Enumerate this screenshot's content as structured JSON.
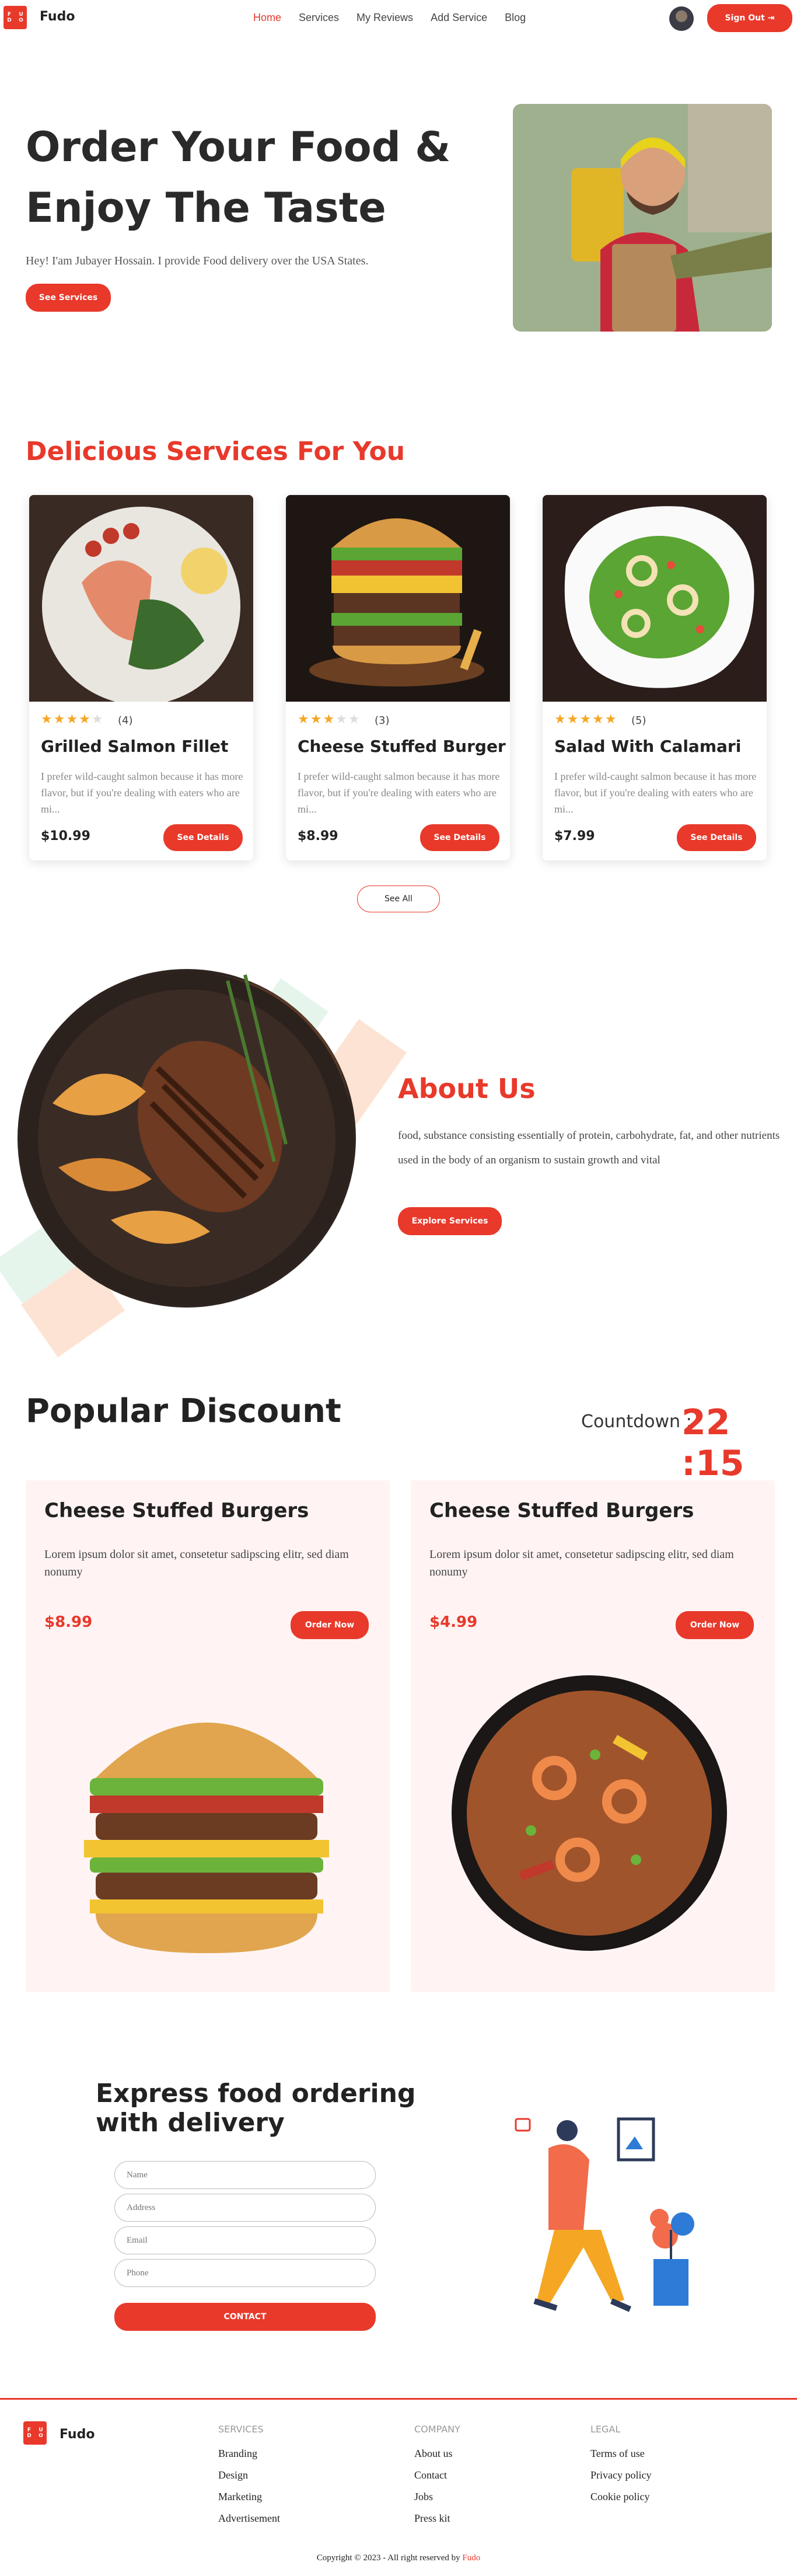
{
  "brand": {
    "logo_letters": [
      "F",
      "U",
      "D",
      "O"
    ],
    "name": "Fudo",
    "accent": "#e8392b"
  },
  "nav": {
    "links": [
      "Home",
      "Services",
      "My Reviews",
      "Add Service",
      "Blog"
    ],
    "active": "Home",
    "signout_label": "Sign Out"
  },
  "hero": {
    "title_line1": "Order Your Food &",
    "title_line2": "Enjoy The Taste",
    "subtitle": "Hey! I'am Jubayer Hossain. I provide Food delivery over the USA States.",
    "button": "See Services"
  },
  "services": {
    "title": "Delicious Services For You",
    "items": [
      {
        "rating": 4,
        "count": "(4)",
        "title": "Grilled Salmon Fillet",
        "desc": "I prefer wild-caught salmon because it has more flavor, but if you're dealing with eaters who are mi...",
        "price": "$10.99",
        "button": "See Details"
      },
      {
        "rating": 3,
        "count": "(3)",
        "title": "Cheese Stuffed Burger",
        "desc": "I prefer wild-caught salmon because it has more flavor, but if you're dealing with eaters who are mi...",
        "price": "$8.99",
        "button": "See Details"
      },
      {
        "rating": 5,
        "count": "(5)",
        "title": "Salad With Calamari",
        "desc": "I prefer wild-caught salmon because it has more flavor, but if you're dealing with eaters who are mi...",
        "price": "$7.99",
        "button": "See Details"
      }
    ],
    "see_all": "See All"
  },
  "about": {
    "title": "About Us",
    "text": "food, substance consisting essentially of protein, carbohydrate, fat, and other nutrients used in the body of an organism to sustain growth and vital",
    "button": "Explore Services"
  },
  "discount": {
    "title": "Popular Discount",
    "countdown_label": "Countdown :",
    "countdown_value": "22 :15",
    "cards": [
      {
        "title": "Cheese Stuffed Burgers",
        "desc": "Lorem ipsum dolor sit amet, consetetur sadipscing elitr, sed diam nonumy",
        "price": "$8.99",
        "button": "Order Now"
      },
      {
        "title": "Cheese Stuffed Burgers",
        "desc": "Lorem ipsum dolor sit amet, consetetur sadipscing elitr, sed diam nonumy",
        "price": "$4.99",
        "button": "Order Now"
      }
    ]
  },
  "contact": {
    "title_line1": "Express food ordering",
    "title_line2": "with delivery",
    "placeholders": {
      "name": "Name",
      "address": "Address",
      "email": "Email",
      "phone": "Phone"
    },
    "button": "CONTACT"
  },
  "footer": {
    "columns": [
      {
        "heading": "SERVICES",
        "items": [
          "Branding",
          "Design",
          "Marketing",
          "Advertisement"
        ]
      },
      {
        "heading": "COMPANY",
        "items": [
          "About us",
          "Contact",
          "Jobs",
          "Press kit"
        ]
      },
      {
        "heading": "LEGAL",
        "items": [
          "Terms of use",
          "Privacy policy",
          "Cookie policy"
        ]
      }
    ],
    "copyright": "Copyright © 2023 - All right reserved by",
    "copyright_brand": "Fudo"
  }
}
